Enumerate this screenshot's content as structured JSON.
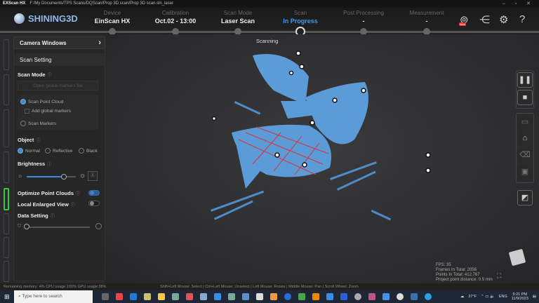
{
  "titlebar": {
    "app": "EXScan HX",
    "path": "F:/My Documents/TPS Scans/DQScan/Prop 3D scan/Prop 3D scan.sln_laser"
  },
  "header": {
    "logo": "SHINING3D",
    "steps": [
      {
        "label": "Device",
        "value": "EinScan HX"
      },
      {
        "label": "Calibration",
        "value": "Oct.02 - 13:00"
      },
      {
        "label": "Scan Mode",
        "value": "Laser Scan"
      },
      {
        "label": "Scan",
        "value": "In Progress"
      },
      {
        "label": "Post Processing",
        "value": "-"
      },
      {
        "label": "Measurement",
        "value": "-"
      }
    ],
    "new_badge": "New"
  },
  "panel": {
    "camera_windows": "Camera Windows",
    "scan_setting": "Scan Setting",
    "scan_mode": "Scan Mode",
    "open_markers": "Open global markers file",
    "scan_point_cloud": "Scan Point Cloud",
    "add_global_markers": "Add  global markers",
    "scan_markers": "Scan Markers",
    "object": "Object",
    "normal": "Normal",
    "reflective": "Reflective",
    "black": "Black",
    "brightness": "Brightness",
    "brightness_value": 0.75,
    "optimize": "Optimize Point Clouds",
    "local_enlarged": "Local Enlarged View",
    "data_setting": "Data Setting",
    "data_setting_value": 0.0
  },
  "viewport": {
    "status": "Scanning"
  },
  "stats": {
    "fps": "FPS:  35",
    "frames": "Frames In Total: 2056",
    "points": "Points In Total: 412,767",
    "distance": "Project point distance: 0.5 mm"
  },
  "statusbar": {
    "resources": "Remaining memory: 4% CPU usage:100%  GPU usage:38%",
    "hint": "Shift+Left Mouse: Select | Ctrl+Left Mouse: Unselect | Left Mouse: Rotate | Middle Mouse: Pan | Scroll Wheel: Zoom"
  },
  "taskbar": {
    "search_placeholder": "Type here to search",
    "weather": "37°F",
    "lang": "ENG",
    "time": "9:21 PM",
    "date": "11/9/2023"
  }
}
